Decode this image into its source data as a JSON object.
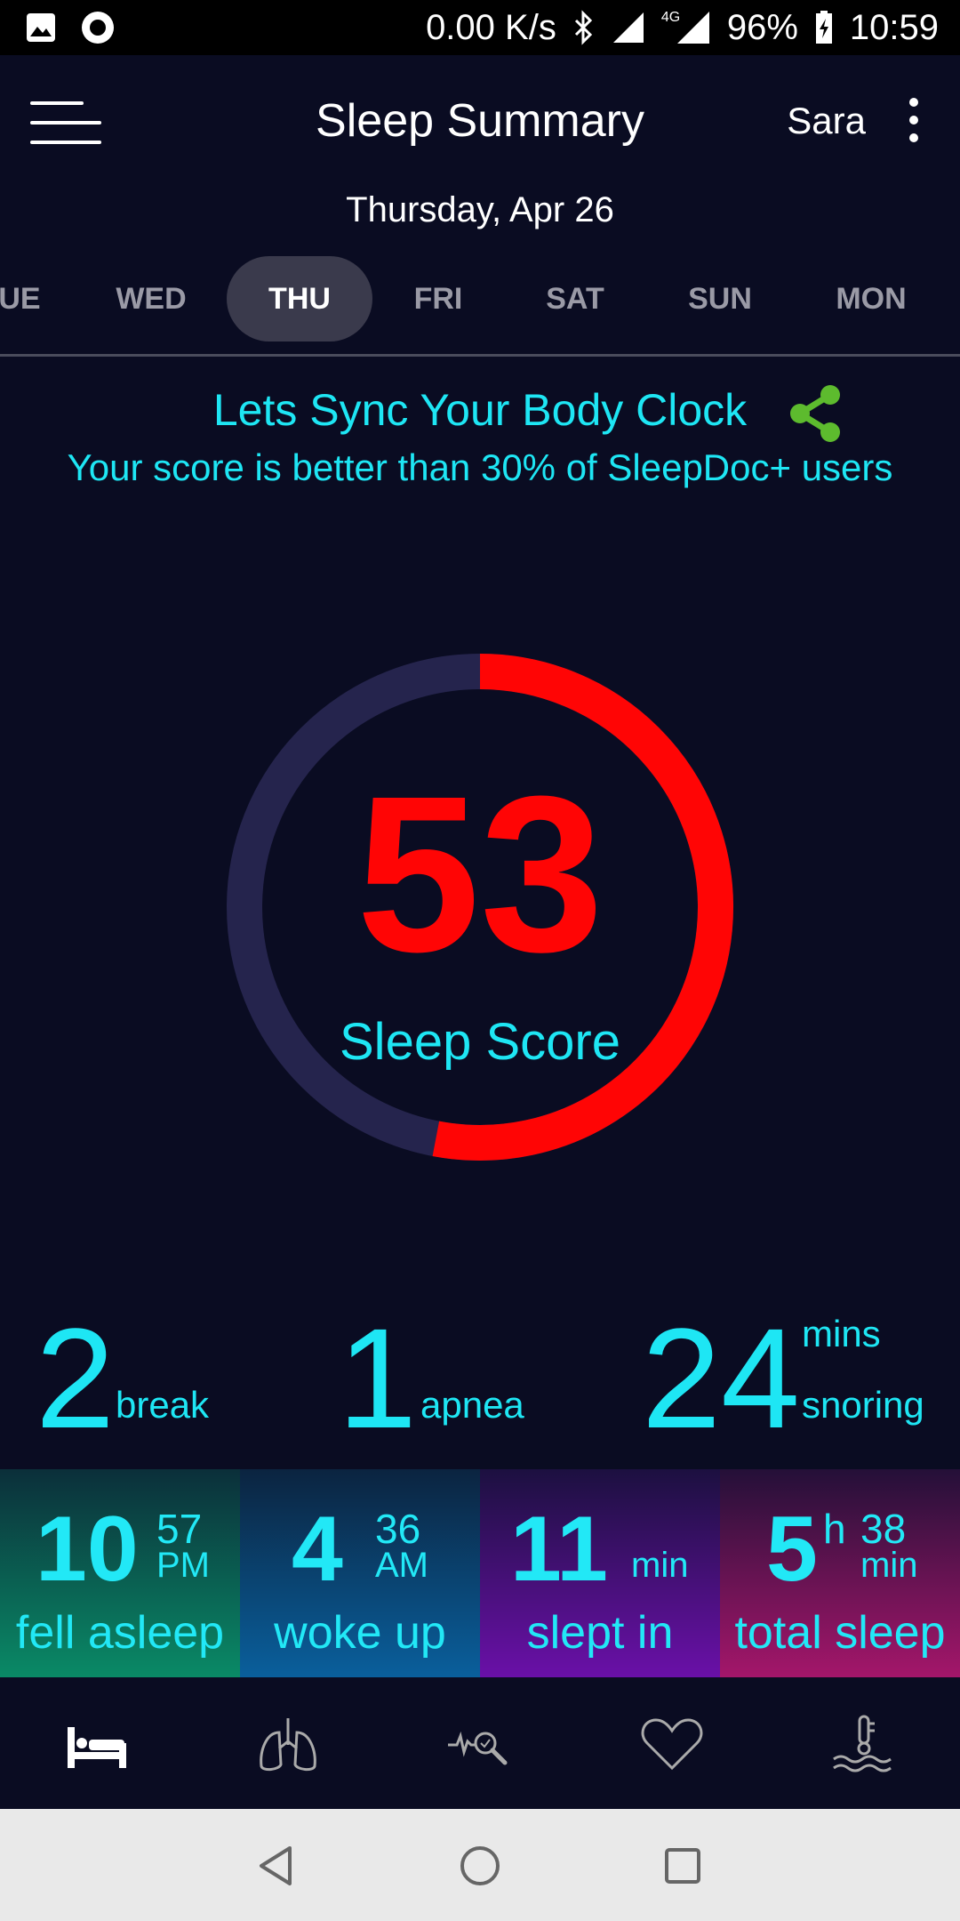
{
  "status_bar": {
    "speed": "0.00 K/s",
    "network": "4G",
    "battery": "96%",
    "time": "10:59"
  },
  "header": {
    "title": "Sleep Summary",
    "user": "Sara"
  },
  "date": "Thursday, Apr 26",
  "days": [
    "UE",
    "WED",
    "THU",
    "FRI",
    "SAT",
    "SUN",
    "MON"
  ],
  "selected_day": "THU",
  "sync": {
    "title": "Lets Sync Your Body Clock",
    "comparison": "Your score is better than 30% of SleepDoc+ users"
  },
  "score": {
    "value": "53",
    "label": "Sleep Score",
    "fraction": 0.53,
    "color": "#ff0505",
    "track_color": "#25244d"
  },
  "metrics": {
    "breaks": {
      "value": "2",
      "unit": "break"
    },
    "apnea": {
      "value": "1",
      "unit": "apnea"
    },
    "snoring": {
      "value": "24",
      "unit_top": "mins",
      "unit_bottom": "snoring"
    }
  },
  "tiles": {
    "fell_asleep": {
      "hour": "10",
      "minute": "57",
      "period": "PM",
      "label": "fell asleep"
    },
    "woke_up": {
      "hour": "4",
      "minute": "36",
      "period": "AM",
      "label": "woke up"
    },
    "slept_in": {
      "value": "11",
      "unit": "min",
      "label": "slept in"
    },
    "total_sleep": {
      "hours": "5",
      "h_unit": "h",
      "minutes": "38",
      "min_unit": "min",
      "label": "total sleep"
    }
  },
  "bottom_nav": [
    "bed-icon",
    "lungs-icon",
    "heartbeat-search-icon",
    "heart-icon",
    "temperature-water-icon"
  ]
}
